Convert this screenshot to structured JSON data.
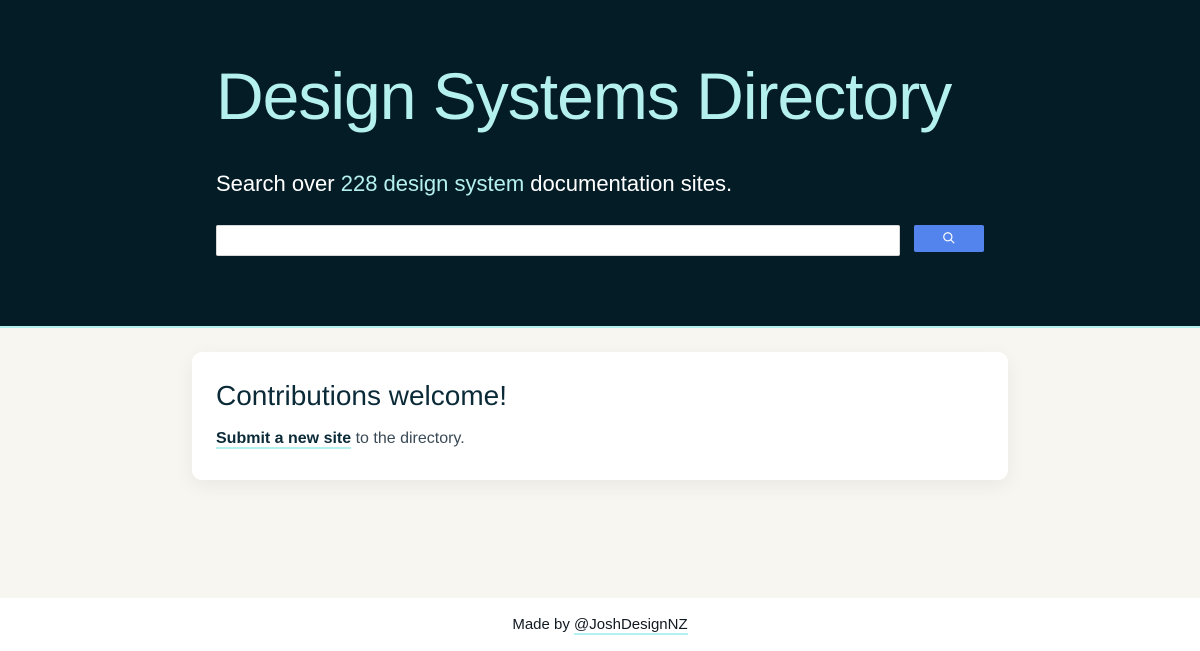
{
  "hero": {
    "title": "Design Systems Directory",
    "subtitle_prefix": "Search over ",
    "subtitle_count": "228 design system",
    "subtitle_suffix": " documentation sites."
  },
  "search": {
    "value": "",
    "placeholder": ""
  },
  "card": {
    "heading": "Contributions welcome!",
    "link_text": "Submit a new site",
    "tail_text": " to the directory."
  },
  "footer": {
    "prefix": "Made by ",
    "handle": "@JoshDesignNZ"
  }
}
